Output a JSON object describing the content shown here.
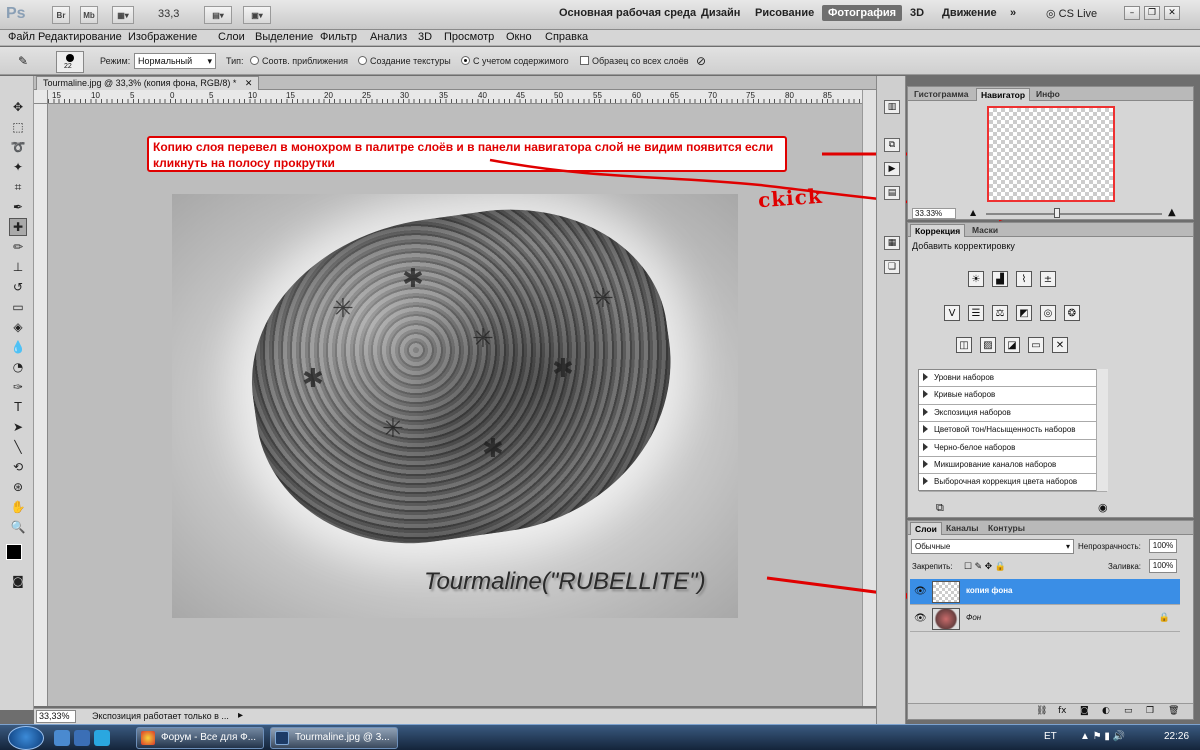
{
  "appbar": {
    "logo": "Ps",
    "btn_br": "Br",
    "btn_mb": "Mb",
    "zoom": "33,3",
    "workspaces": [
      "Основная рабочая среда",
      "Дизайн",
      "Рисование",
      "Фотография",
      "3D",
      "Движение"
    ],
    "active_workspace": "Фотография",
    "more": "»",
    "cslive": "CS Live"
  },
  "menu": [
    "Файл",
    "Редактирование",
    "Изображение",
    "Слои",
    "Выделение",
    "Фильтр",
    "Анализ",
    "3D",
    "Просмотр",
    "Окно",
    "Справка"
  ],
  "options": {
    "brush_size": "22",
    "mode_label": "Режим:",
    "mode_value": "Нормальный",
    "type_label": "Тип:",
    "type_options": [
      "Соотв. приближения",
      "Создание текстуры",
      "С учетом содержимого"
    ],
    "type_selected": "С учетом содержимого",
    "sample_all": "Образец со всех слоёв"
  },
  "document": {
    "tab_title": "Tourmaline.jpg @ 33,3% (копия фона, RGB/8) *",
    "ruler_top": [
      "15",
      "10",
      "5",
      "0",
      "5",
      "10",
      "15",
      "20",
      "25",
      "30",
      "35",
      "40",
      "45",
      "50",
      "55",
      "60",
      "65",
      "70",
      "75",
      "80",
      "85"
    ],
    "image_caption": "Tourmaline(\"RUBELLITE\")",
    "annotation": "Копию слоя перевел в монохром в палитре слоёв и в панели навигатора слой не видим появится если кликнуть на полосу прокрутки",
    "click_text": "ckick"
  },
  "statusbar": {
    "zoom": "33,33%",
    "message": "Экспозиция работает только в ..."
  },
  "navigator": {
    "tabs": [
      "Гистограмма",
      "Навигатор",
      "Инфо"
    ],
    "active": "Навигатор",
    "zoom": "33.33%",
    "zoom_level": 0.333
  },
  "corrections": {
    "tabs": [
      "Коррекция",
      "Маски"
    ],
    "active": "Коррекция",
    "title": "Добавить корректировку",
    "presets": [
      "Уровни наборов",
      "Кривые наборов",
      "Экспозиция наборов",
      "Цветовой тон/Насыщенность наборов",
      "Черно-белое наборов",
      "Микширование каналов наборов",
      "Выборочная коррекция цвета наборов"
    ]
  },
  "layers": {
    "tabs": [
      "Слои",
      "Каналы",
      "Контуры"
    ],
    "active": "Слои",
    "blend_mode": "Обычные",
    "opacity_label": "Непрозрачность:",
    "opacity": "100%",
    "lock_label": "Закрепить:",
    "fill_label": "Заливка:",
    "fill": "100%",
    "items": [
      {
        "name": "копия фона",
        "selected": true
      },
      {
        "name": "Фон",
        "selected": false
      }
    ]
  },
  "taskbar": {
    "tasks": [
      "Форум - Все для Ф...",
      "Tourmaline.jpg @ 3..."
    ],
    "lang": "ET",
    "time": "22:26"
  }
}
